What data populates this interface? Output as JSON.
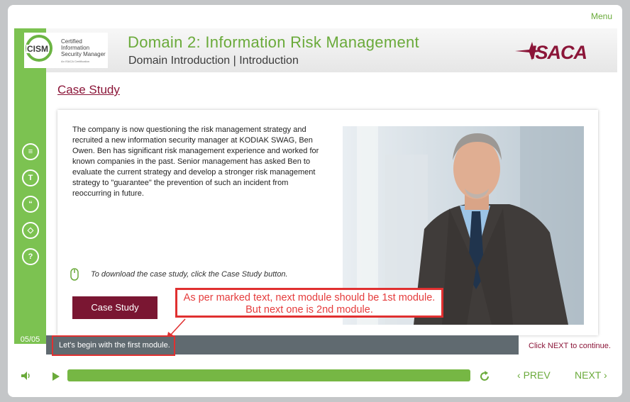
{
  "topbar": {
    "menu_label": "Menu"
  },
  "header": {
    "title": "Domain 2: Information Risk Management",
    "subtitle": "Domain Introduction | Introduction",
    "cism_logo": {
      "acronym": "CISM",
      "line1": "Certified Information",
      "line2": "Security Manager",
      "tagline": "An ISACA Certification"
    },
    "isaca_logo": "ISACA"
  },
  "sidebar": {
    "icons": [
      "document-icon",
      "text-icon",
      "quote-icon",
      "layers-icon",
      "help-icon"
    ],
    "icon_glyphs": [
      "≡",
      "T",
      "“",
      "◇",
      "?"
    ],
    "page_indicator": "05/05"
  },
  "main": {
    "section_title": "Case Study",
    "case_text": "The company is now questioning the risk management strategy and recruited a new information security manager at KODIAK SWAG, Ben Owen. Ben has significant risk management experience and worked for known companies in the past. Senior management has asked Ben to evaluate the current strategy and develop a stronger risk management strategy to \"guarantee\" the prevention of such an incident from reoccurring in future.",
    "download_note": "To download the case study, click the Case Study button.",
    "case_study_button": "Case Study"
  },
  "annotation": {
    "text": "As per marked text, next module should be 1st module. But next one is 2nd module."
  },
  "caption": {
    "text": "Let's begin with the first module.",
    "click_next": "Click NEXT to continue."
  },
  "player": {
    "progress": 1.0,
    "prev_label": "PREV",
    "next_label": "NEXT"
  },
  "colors": {
    "brand_green": "#7cc251",
    "accent_maroon": "#7a1632",
    "annotation_red": "#e03030"
  }
}
